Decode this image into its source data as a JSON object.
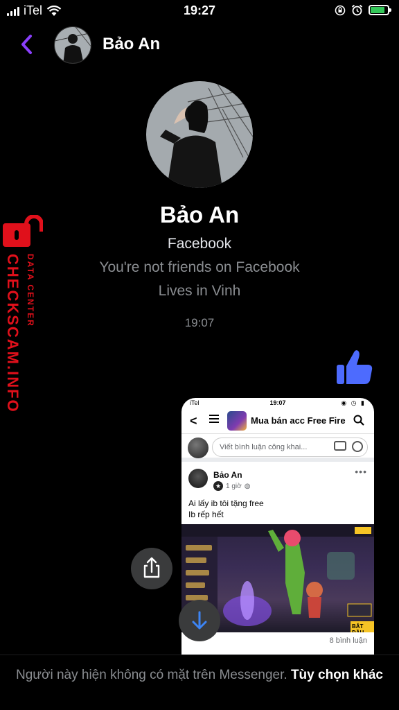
{
  "status_bar": {
    "carrier": "iTel",
    "time": "19:27"
  },
  "header": {
    "name": "Bảo An"
  },
  "profile": {
    "name": "Bảo An",
    "source": "Facebook",
    "friend_status": "You're not friends on Facebook",
    "lives_in": "Lives in Vinh"
  },
  "conversation": {
    "timestamp": "19:07"
  },
  "watermark": {
    "main": "CHECKSCAM.INFO",
    "sub": "DATA CENTER"
  },
  "shared_screenshot": {
    "status_carrier": "iTel",
    "status_time": "19:07",
    "group_name": "Mua bán acc Free Fire",
    "comment_placeholder": "Viết bình luận công khai...",
    "post_author": "Bảo An",
    "post_time": "1 giờ",
    "post_line1": "Ai lấy ib tôi tặng free",
    "post_line2": "Ib rếp hết",
    "comment_count": "8 bình luận",
    "game_start_label": "BẮT ĐẦU"
  },
  "footer": {
    "message": "Người này hiện không có mặt trên Messenger.",
    "link": "Tùy chọn khác"
  },
  "colors": {
    "accent": "#8a3ffc",
    "like": "#4d6bfe",
    "watermark": "#e0101b"
  }
}
